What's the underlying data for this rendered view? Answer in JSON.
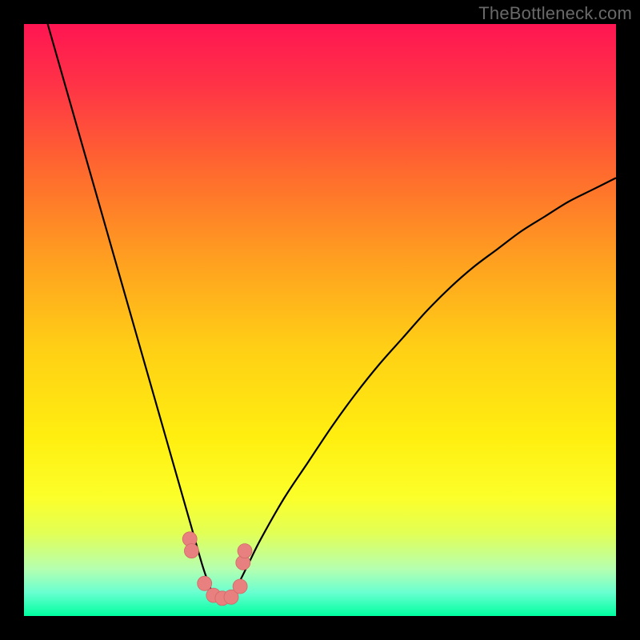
{
  "watermark": "TheBottleneck.com",
  "colors": {
    "gradient_top": "#ff1552",
    "gradient_bottom": "#00ffa0",
    "curve": "#000000",
    "markers": "#e88080",
    "frame": "#000000"
  },
  "chart_data": {
    "type": "line",
    "title": "",
    "xlabel": "",
    "ylabel": "",
    "xlim": [
      0,
      100
    ],
    "ylim": [
      0,
      100
    ],
    "minimum_x": 33,
    "series": [
      {
        "name": "curve",
        "x": [
          4,
          6,
          8,
          10,
          12,
          14,
          16,
          18,
          20,
          22,
          24,
          26,
          28,
          30,
          31,
          32,
          33,
          34,
          35,
          36,
          38,
          40,
          44,
          48,
          52,
          56,
          60,
          64,
          68,
          72,
          76,
          80,
          84,
          88,
          92,
          96,
          100
        ],
        "y": [
          100,
          93,
          86,
          79,
          72,
          65,
          58,
          51,
          44,
          37,
          30,
          23,
          16,
          9,
          6,
          3.5,
          2,
          2.3,
          3.3,
          5,
          9,
          13,
          20,
          26,
          32,
          37.5,
          42.5,
          47,
          51.5,
          55.5,
          59,
          62,
          65,
          67.5,
          70,
          72,
          74
        ]
      }
    ],
    "markers": {
      "name": "highlight-points",
      "x": [
        28,
        28.3,
        30.5,
        32,
        33.5,
        35,
        36.5,
        37,
        37.3
      ],
      "y": [
        13,
        11,
        5.5,
        3.5,
        3,
        3.2,
        5,
        9,
        11
      ]
    }
  }
}
